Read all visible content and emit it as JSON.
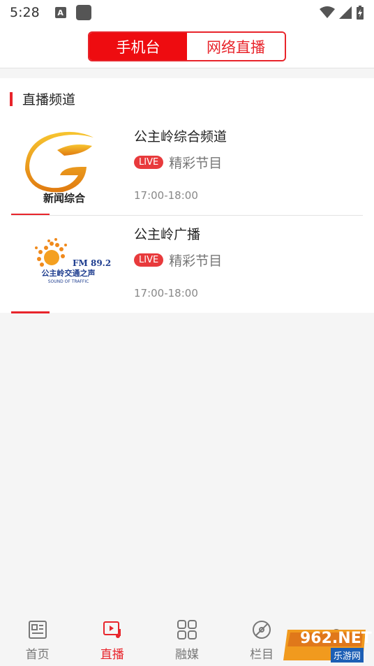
{
  "status": {
    "time": "5:28",
    "a_icon": "A"
  },
  "tabs": {
    "active": "手机台",
    "inactive": "网络直播"
  },
  "section": {
    "title": "直播频道"
  },
  "channels": [
    {
      "name": "公主岭综合频道",
      "live": "LIVE",
      "subtitle": "精彩节目",
      "time": "17:00-18:00",
      "logo_text": "新闻综合"
    },
    {
      "name": "公主岭广播",
      "live": "LIVE",
      "subtitle": "精彩节目",
      "time": "17:00-18:00",
      "logo_fm": "FM 89.2",
      "logo_cn": "公主岭交通之声",
      "logo_en": "SOUND OF TRAFFIC"
    }
  ],
  "nav": [
    {
      "label": "首页",
      "icon": "news-icon"
    },
    {
      "label": "直播",
      "icon": "live-play-icon"
    },
    {
      "label": "融媒",
      "icon": "grid-icon"
    },
    {
      "label": "栏目",
      "icon": "disc-icon"
    },
    {
      "label": "",
      "icon": "user-icon"
    }
  ],
  "watermark": {
    "text": "962.NET",
    "sub": "乐游网"
  },
  "colors": {
    "accent": "#e8242b"
  }
}
